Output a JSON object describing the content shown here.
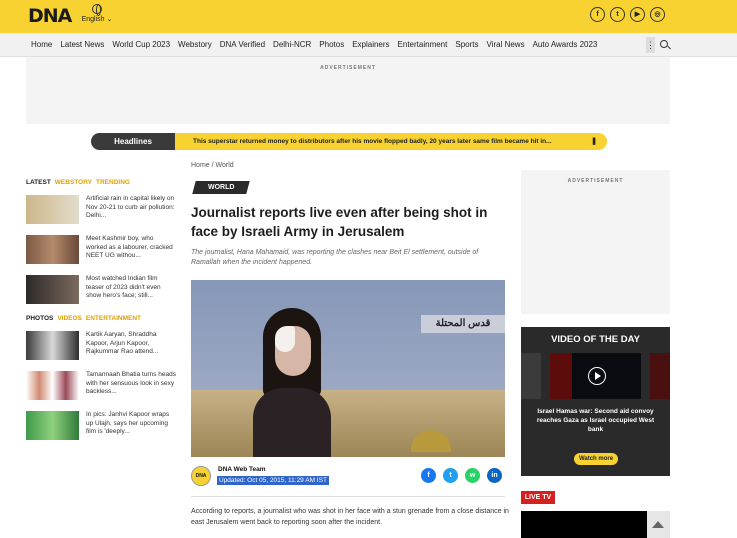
{
  "header": {
    "logo": "DNA",
    "language": "English",
    "socials": [
      "f",
      "t",
      "▶",
      "◎"
    ]
  },
  "nav": {
    "items": [
      "Home",
      "Latest News",
      "World Cup 2023",
      "Webstory",
      "DNA Verified",
      "Delhi-NCR",
      "Photos",
      "Explainers",
      "Entertainment",
      "Sports",
      "Viral News",
      "Auto Awards 2023"
    ],
    "more": "⋮"
  },
  "ads": {
    "label": "ADVERTISEMENT"
  },
  "headlines": {
    "tag": "Headlines",
    "text": "This superstar returned money to distributors after his movie flopped badly, 20 years later same film became hit in...",
    "arrow": "❚"
  },
  "sidebar": {
    "tabs1": [
      "LATEST",
      "WEBSTORY",
      "TRENDING"
    ],
    "latest": [
      {
        "text": "Artificial rain in capital likely on Nov 20-21 to curb air pollution: Delhi..."
      },
      {
        "text": "Meet Kashmir boy, who worked as a labourer, cracked NEET UG withou..."
      },
      {
        "text": "Most watched Indian film teaser of 2023 didn't even show hero's face; still..."
      }
    ],
    "tabs2": [
      "PHOTOS",
      "VIDEOS",
      "ENTERTAINMENT"
    ],
    "photos": [
      {
        "text": "Kartik Aaryan, Shraddha Kapoor, Arjun Kapoor, Rajkummar Rao attend..."
      },
      {
        "text": "Tamannaah Bhatia turns heads with her sensuous look in sexy backless..."
      },
      {
        "text": "In pics: Janhvi Kapoor wraps up Ulajh, says her upcoming film is 'deeply..."
      }
    ]
  },
  "article": {
    "breadcrumb_home": "Home",
    "breadcrumb_sep": "/",
    "breadcrumb_section": "World",
    "tag": "WORLD",
    "title": "Journalist reports live even after being shot in face by Israeli Army in Jerusalem",
    "subtitle": "The journalist, Hana Mahamaid, was reporting the clashes near Beit El settlement, outside of Ramallah when the incident happened.",
    "image_banner": "قدس المحتلة",
    "avatar": "DNA",
    "author": "DNA Web Team",
    "updated": "Updated: Oct 05, 2015, 11:29 AM IST",
    "share": [
      "f",
      "t",
      "w",
      "in"
    ],
    "body": "According to reports, a journalist who was shot in her face with a stun grenade from a close distance in east Jerusalem went back to reporting soon after the incident."
  },
  "right": {
    "video_title": "VIDEO OF THE DAY",
    "video_caption": "Israel Hamas war: Second aid convoy reaches Gaza as Israel occupied West bank",
    "watch": "Watch more",
    "live_tv": "LIVE TV"
  },
  "colors": {
    "brand_yellow": "#f7d231",
    "dark": "#2b2b2b",
    "live_red": "#d61f1f",
    "highlight_blue": "#2f66c8"
  }
}
